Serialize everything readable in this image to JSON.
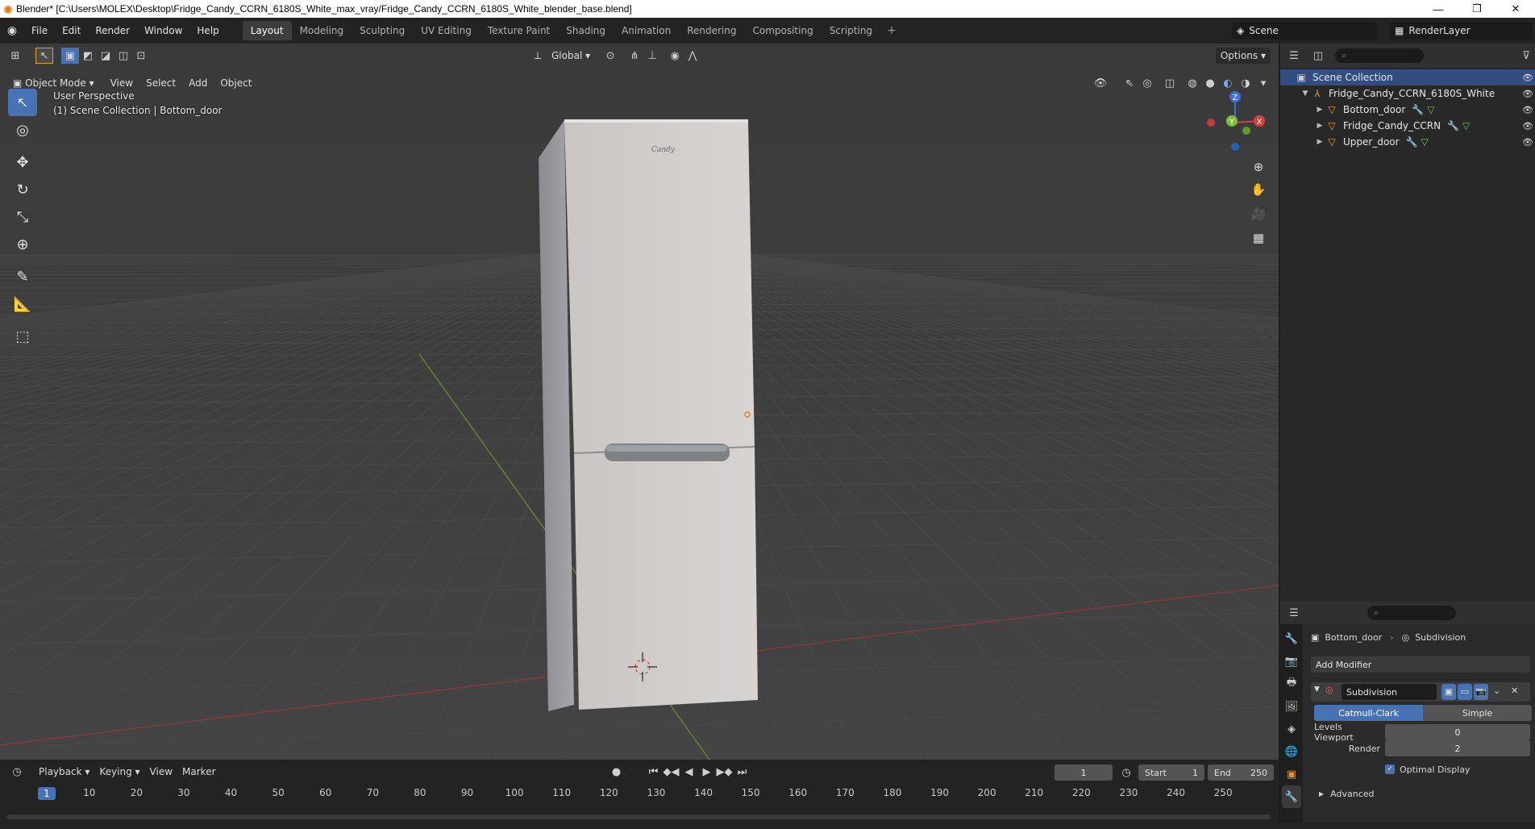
{
  "window": {
    "title": "Blender* [C:\\Users\\MOLEX\\Desktop\\Fridge_Candy_CCRN_6180S_White_max_vray/Fridge_Candy_CCRN_6180S_White_blender_base.blend]"
  },
  "menu": [
    "File",
    "Edit",
    "Render",
    "Window",
    "Help"
  ],
  "workspaces": [
    {
      "label": "Layout",
      "active": true
    },
    {
      "label": "Modeling",
      "active": false
    },
    {
      "label": "Sculpting",
      "active": false
    },
    {
      "label": "UV Editing",
      "active": false
    },
    {
      "label": "Texture Paint",
      "active": false
    },
    {
      "label": "Shading",
      "active": false
    },
    {
      "label": "Animation",
      "active": false
    },
    {
      "label": "Rendering",
      "active": false
    },
    {
      "label": "Compositing",
      "active": false
    },
    {
      "label": "Scripting",
      "active": false
    }
  ],
  "scene": {
    "name": "Scene",
    "render_layer": "RenderLayer"
  },
  "viewport": {
    "mode": "Object Mode",
    "menus": [
      "View",
      "Select",
      "Add",
      "Object"
    ],
    "transform_orientation": "Global",
    "options_label": "Options",
    "info_line1": "User Perspective",
    "info_line2": "(1) Scene Collection | Bottom_door",
    "brand_label": "Candy",
    "gizmo": {
      "x": "X",
      "y": "Y",
      "z": "Z"
    }
  },
  "outliner": {
    "root": "Scene Collection",
    "collection": "Fridge_Candy_CCRN_6180S_White",
    "objects": [
      "Bottom_door",
      "Fridge_Candy_CCRN",
      "Upper_door"
    ]
  },
  "properties": {
    "object": "Bottom_door",
    "modifier_context": "Subdivision",
    "add_modifier": "Add Modifier",
    "modifier_name": "Subdivision",
    "mode_a": "Catmull-Clark",
    "mode_b": "Simple",
    "levels_viewport_label": "Levels Viewport",
    "levels_viewport": "0",
    "render_label": "Render",
    "render_levels": "2",
    "optimal_display": "Optimal Display",
    "advanced": "Advanced"
  },
  "timeline": {
    "menus": [
      "Playback",
      "Keying",
      "View",
      "Marker"
    ],
    "current_frame": "1",
    "start_label": "Start",
    "start": "1",
    "end_label": "End",
    "end": "250",
    "ticks": [
      "10",
      "20",
      "30",
      "40",
      "50",
      "60",
      "70",
      "80",
      "90",
      "100",
      "110",
      "120",
      "130",
      "140",
      "150",
      "160",
      "170",
      "180",
      "190",
      "200",
      "210",
      "220",
      "230",
      "240",
      "250"
    ],
    "playhead": "1"
  }
}
